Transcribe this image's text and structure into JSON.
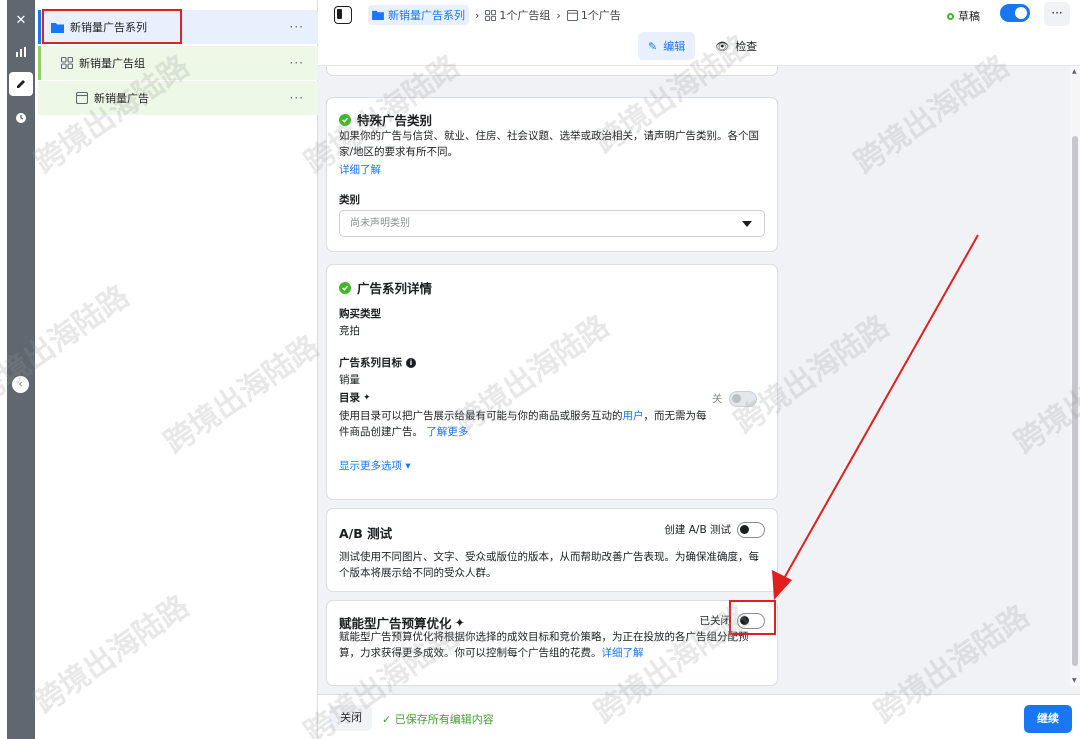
{
  "tree": {
    "campaign": "新销量广告系列",
    "adset": "新销量广告组",
    "ad": "新销量广告",
    "more": "···"
  },
  "topbar": {
    "crumb_campaign": "新销量广告系列",
    "crumb_adsets": "1个广告组",
    "crumb_ads": "1个广告",
    "status": "草稿",
    "more": "···",
    "tab_edit": "编辑",
    "tab_review": "检查"
  },
  "special": {
    "title": "特殊广告类别",
    "desc": "如果你的广告与信贷、就业、住房、社会议题、选举或政治相关，请声明广告类别。各个国家/地区的要求有所不同。",
    "learn_more": "详细了解",
    "category_label": "类别",
    "category_placeholder": "尚未声明类别"
  },
  "details": {
    "title": "广告系列详情",
    "buy_type_label": "购买类型",
    "buy_type_value": "竞拍",
    "objective_label": "广告系列目标",
    "objective_value": "销量",
    "catalog_label": "目录",
    "catalog_toggle": "关",
    "catalog_desc_1": "使用目录可以把广告展示给最有可能与你的商品或服务互动的",
    "catalog_desc_link": "用户",
    "catalog_desc_2": "，而无需为每件商品创建广告。",
    "learn_more": "了解更多",
    "more_options": "显示更多选项"
  },
  "ab": {
    "title": "A/B 测试",
    "toggle_label": "创建 A/B 测试",
    "desc": "测试使用不同图片、文字、受众或版位的版本，从而帮助改善广告表现。为确保准确度，每个版本将展示给不同的受众人群。"
  },
  "cbo": {
    "title": "赋能型广告预算优化",
    "toggle_label": "已关闭",
    "desc": "赋能型广告预算优化将根据你选择的成效目标和竞价策略，为正在投放的各广告组分配预算，力求获得更多成效。你可以控制每个广告组的花费。",
    "learn_more": "详细了解"
  },
  "bottom": {
    "close": "关闭",
    "saved": "已保存所有编辑内容",
    "continue": "继续"
  },
  "watermark": "跨境出海陆路",
  "colors": {
    "accent": "#1877f2",
    "success": "#42b72a",
    "annotation": "#e02020"
  }
}
